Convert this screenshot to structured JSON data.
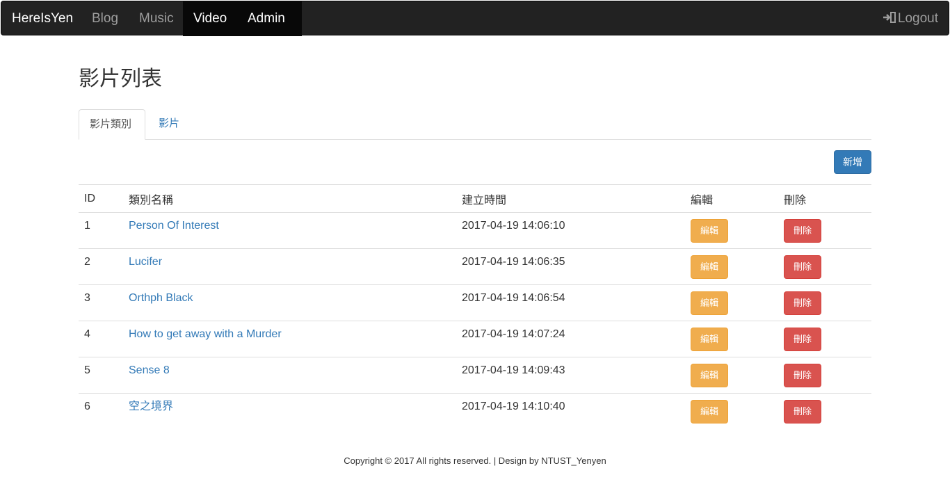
{
  "nav": {
    "brand": "HereIsYen",
    "blog": "Blog",
    "music": "Music",
    "video": "Video",
    "admin": "Admin",
    "logout": "Logout"
  },
  "page": {
    "title": "影片列表"
  },
  "tabs": [
    {
      "label": "影片類別"
    },
    {
      "label": "影片"
    }
  ],
  "actions": {
    "add_label": "新增"
  },
  "table": {
    "headers": [
      "ID",
      "類別名稱",
      "建立時間",
      "編輯",
      "刪除"
    ],
    "rows": [
      {
        "id": "1",
        "name": "Person Of Interest",
        "created": "2017-04-19 14:06:10",
        "edit": "編輯",
        "delete": "刪除"
      },
      {
        "id": "2",
        "name": "Lucifer",
        "created": "2017-04-19 14:06:35",
        "edit": "編輯",
        "delete": "刪除"
      },
      {
        "id": "3",
        "name": "Orthph Black",
        "created": "2017-04-19 14:06:54",
        "edit": "編輯",
        "delete": "刪除"
      },
      {
        "id": "4",
        "name": "How to get away with a Murder",
        "created": "2017-04-19 14:07:24",
        "edit": "編輯",
        "delete": "刪除"
      },
      {
        "id": "5",
        "name": "Sense 8",
        "created": "2017-04-19 14:09:43",
        "edit": "編輯",
        "delete": "刪除"
      },
      {
        "id": "6",
        "name": "空之境界",
        "created": "2017-04-19 14:10:40",
        "edit": "編輯",
        "delete": "刪除"
      }
    ]
  },
  "footer": {
    "text": "Copyright © 2017 All rights reserved. | Design by NTUST_Yenyen"
  },
  "colors": {
    "navbar": "#222222",
    "primary": "#337ab7",
    "warning": "#f0ad4e",
    "danger": "#d9534f"
  },
  "icons": {
    "logout": "log-out-icon",
    "admin_caret": "caret-down-icon"
  }
}
